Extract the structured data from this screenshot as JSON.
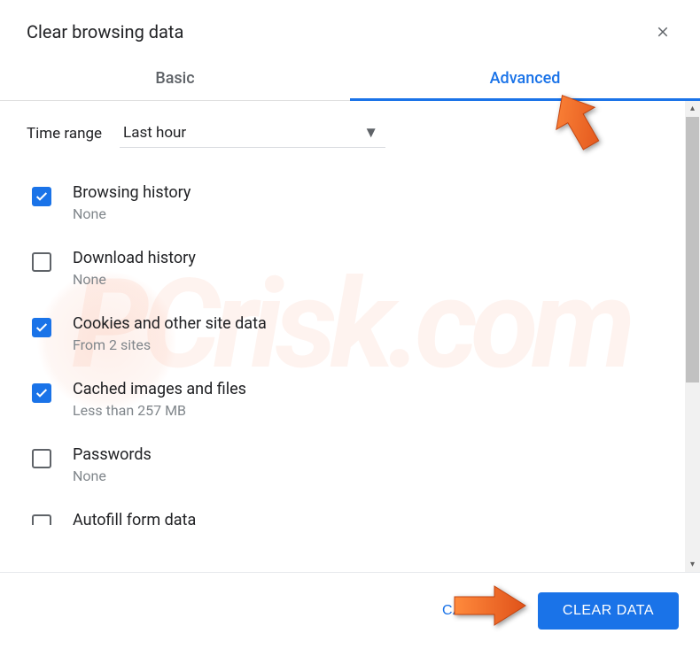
{
  "dialog": {
    "title": "Clear browsing data"
  },
  "tabs": {
    "basic": "Basic",
    "advanced": "Advanced"
  },
  "time_range": {
    "label": "Time range",
    "selected": "Last hour"
  },
  "options": [
    {
      "title": "Browsing history",
      "sub": "None",
      "checked": true
    },
    {
      "title": "Download history",
      "sub": "None",
      "checked": false
    },
    {
      "title": "Cookies and other site data",
      "sub": "From 2 sites",
      "checked": true
    },
    {
      "title": "Cached images and files",
      "sub": "Less than 257 MB",
      "checked": true
    },
    {
      "title": "Passwords",
      "sub": "None",
      "checked": false
    },
    {
      "title": "Autofill form data",
      "sub": "",
      "checked": false
    }
  ],
  "footer": {
    "cancel": "CANCEL",
    "clear": "CLEAR DATA"
  },
  "watermark": "PCrisk.com"
}
